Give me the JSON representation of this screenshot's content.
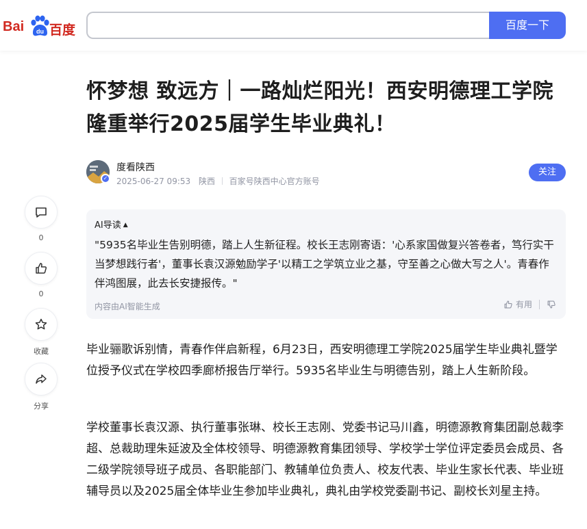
{
  "header": {
    "logo_left": "Bai",
    "logo_right": "百度",
    "search_value": "",
    "search_button": "百度一下"
  },
  "article": {
    "title": "怀梦想 致远方｜一路灿烂阳光！西安明德理工学院隆重举行2025届学生毕业典礼！",
    "author": "度看陕西",
    "date": "2025-06-27 09:53",
    "region": "陕西",
    "account_type": "百家号陕西中心官方账号",
    "follow_label": "关注",
    "paragraphs": [
      "毕业骊歌诉别情，青春作伴启新程，6月23日，西安明德理工学院2025届学生毕业典礼暨学位授予仪式在学校四季廊桥报告厅举行。5935名毕业生与明德告别，踏上人生新阶段。",
      "学校董事长袁汉源、执行董事张琳、校长王志刚、党委书记马川鑫，明德源教育集团副总裁李超、总裁助理朱延波及全体校领导、明德源教育集团领导、学校学士学位评定委员会成员、各二级学院领导班子成员、各职能部门、教辅单位负责人、校友代表、毕业生家长代表、毕业班辅导员以及2025届全体毕业生参加毕业典礼，典礼由学校党委副书记、副校长刘星主持。"
    ]
  },
  "sidebar": {
    "comment_count": "0",
    "like_count": "0",
    "collect_label": "收藏",
    "share_label": "分享"
  },
  "ai_summary": {
    "heading": "AI导读",
    "text": "\"5935名毕业生告别明德，踏上人生新征程。校长王志刚寄语：'心系家国做复兴答卷者，笃行实干当梦想践行者'，董事长袁汉源勉励学子'以精工之学筑立业之基，守至善之心做大写之人'。青春作伴鸿图展，此去长安捷报传。\"",
    "footer": "内容由AI智能生成",
    "useful_label": "有用"
  },
  "colors": {
    "brand_blue": "#4e6ef2",
    "baidu_red": "#d12920"
  }
}
